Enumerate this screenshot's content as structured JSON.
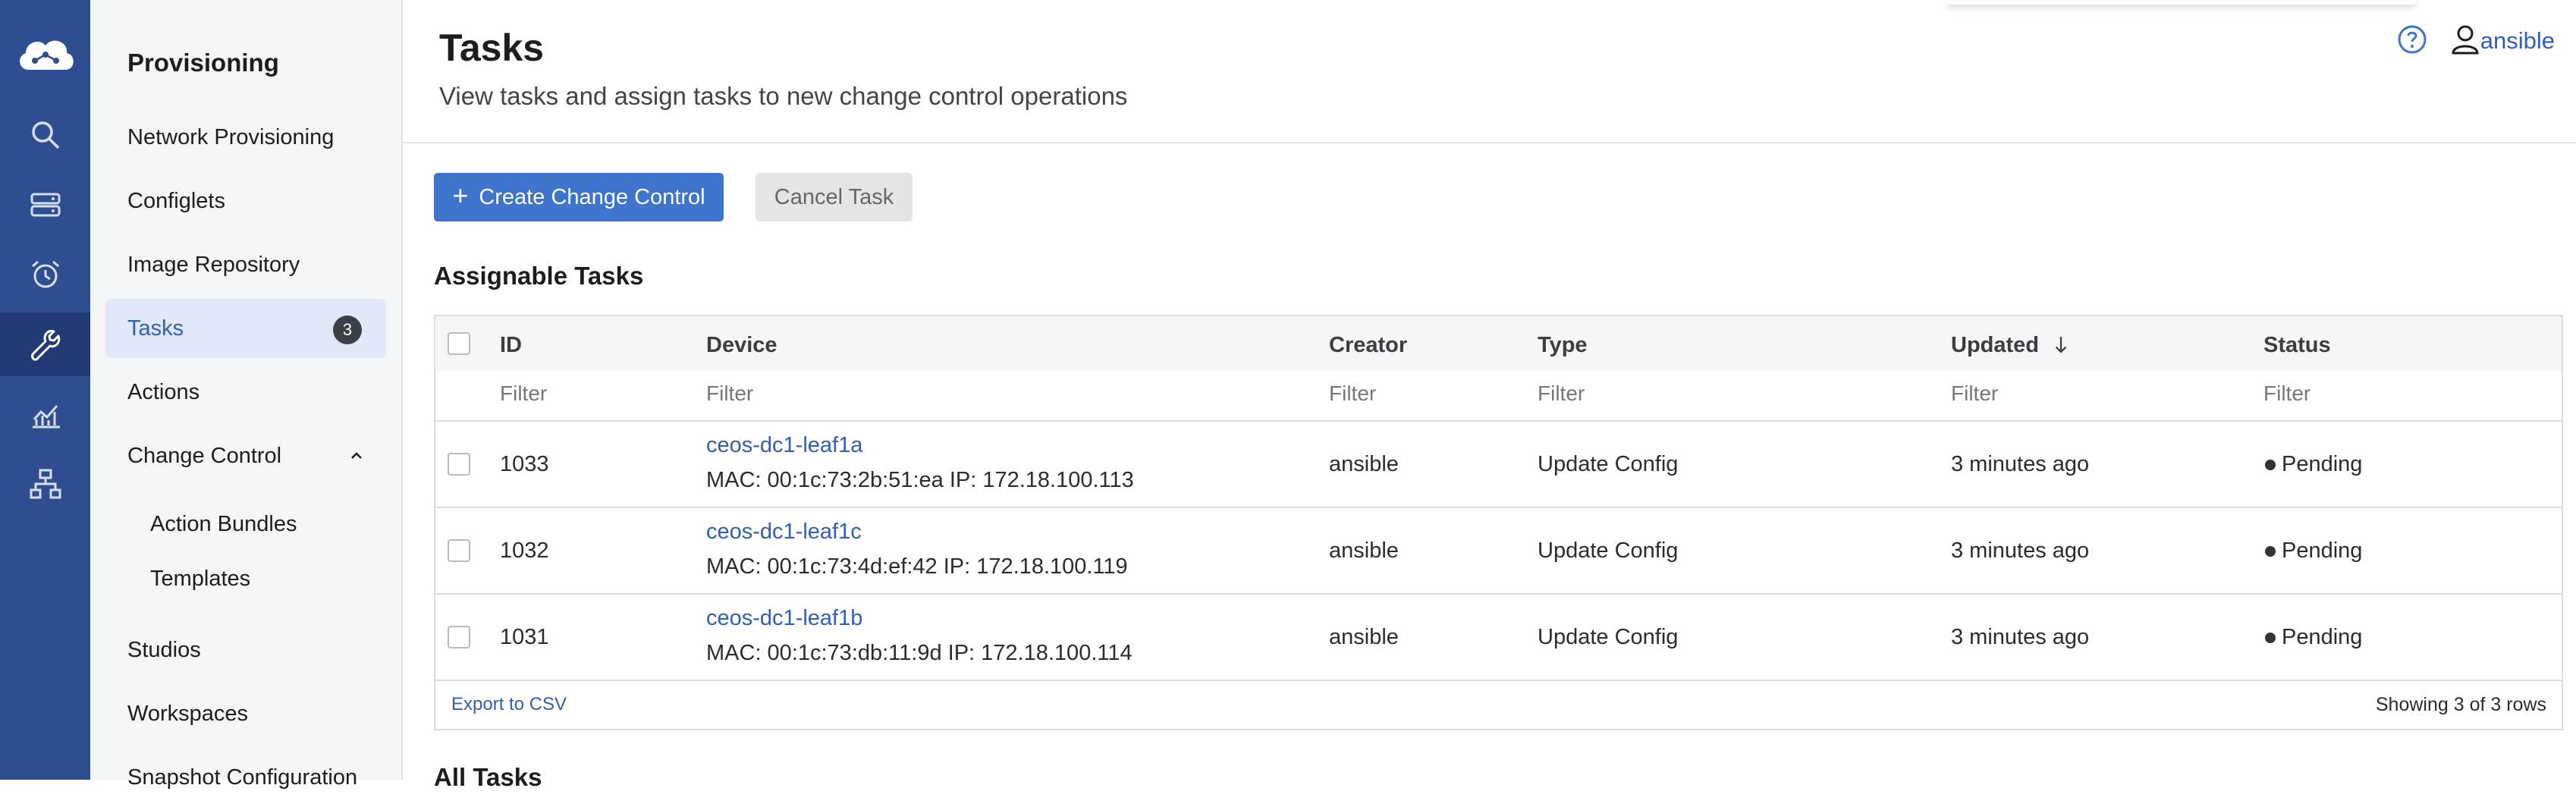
{
  "sidebar": {
    "title": "Provisioning",
    "items": [
      {
        "label": "Network Provisioning"
      },
      {
        "label": "Configlets"
      },
      {
        "label": "Image Repository"
      },
      {
        "label": "Tasks",
        "badge": "3"
      },
      {
        "label": "Actions"
      },
      {
        "label": "Change Control"
      },
      {
        "label": "Action Bundles"
      },
      {
        "label": "Templates"
      },
      {
        "label": "Studios"
      },
      {
        "label": "Workspaces"
      },
      {
        "label": "Snapshot Configuration"
      }
    ]
  },
  "rail_icons": [
    "cloud-logo-icon",
    "search-icon",
    "devices-icon",
    "events-alarm-icon",
    "provisioning-wrench-icon",
    "metrics-chart-icon",
    "topology-icon"
  ],
  "header": {
    "title": "Tasks",
    "subtitle": "View tasks and assign tasks to new change control operations",
    "user": "ansible"
  },
  "toolbar": {
    "create_label": "Create Change Control",
    "cancel_label": "Cancel Task"
  },
  "section": {
    "title": "Assignable Tasks",
    "next_title": "All Tasks"
  },
  "table": {
    "columns": [
      "ID",
      "Device",
      "Creator",
      "Type",
      "Updated",
      "Status"
    ],
    "filter_placeholder": "Filter",
    "rows": [
      {
        "id": "1033",
        "device": "ceos-dc1-leaf1a",
        "meta": "MAC: 00:1c:73:2b:51:ea IP: 172.18.100.113",
        "creator": "ansible",
        "type": "Update Config",
        "updated": "3 minutes ago",
        "status": "Pending"
      },
      {
        "id": "1032",
        "device": "ceos-dc1-leaf1c",
        "meta": "MAC: 00:1c:73:4d:ef:42 IP: 172.18.100.119",
        "creator": "ansible",
        "type": "Update Config",
        "updated": "3 minutes ago",
        "status": "Pending"
      },
      {
        "id": "1031",
        "device": "ceos-dc1-leaf1b",
        "meta": "MAC: 00:1c:73:db:11:9d IP: 172.18.100.114",
        "creator": "ansible",
        "type": "Update Config",
        "updated": "3 minutes ago",
        "status": "Pending"
      }
    ],
    "export_label": "Export to CSV",
    "showing_label": "Showing 3 of 3 rows"
  },
  "colors": {
    "rail": "#2f4e92",
    "accent": "#3e74cc",
    "link": "#2f5fb7"
  }
}
